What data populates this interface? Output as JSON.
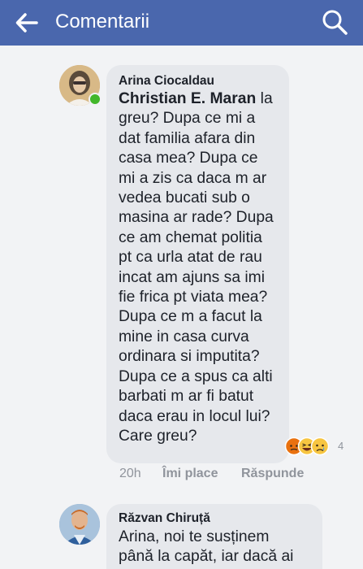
{
  "topbar": {
    "title": "Comentarii",
    "back_icon": "arrow-left-icon",
    "search_icon": "search-icon",
    "color": "#4a67ad"
  },
  "comments": [
    {
      "author": "Arina Ciocaldau",
      "mention": "Christian E. Maran",
      "lines": [
        " la",
        "greu? Dupa ce mi a",
        "dat familia afara din",
        "casa mea? Dupa ce",
        "mi a zis ca daca m ar",
        "vedea bucati sub o",
        "masina ar rade? Dupa",
        "ce am chemat politia",
        "pt ca urla atat de rau",
        "incat am ajuns sa imi",
        "fie frica pt viata mea?",
        "Dupa ce m a facut la",
        "mine in casa curva",
        "ordinara si imputita?",
        "Dupa ce a spus ca alti",
        "barbati m ar fi batut",
        "daca erau in locul lui?",
        "Care greu?"
      ],
      "reactions": [
        "angry-reaction-icon",
        "haha-reaction-icon",
        "sad-reaction-icon"
      ],
      "reaction_count": "4",
      "time": "20h",
      "like_label": "Îmi place",
      "reply_label": "Răspunde",
      "online": true
    },
    {
      "author": "Răzvan Chiruță",
      "lines": [
        "Arina, noi te susținem",
        "până la capăt, iar dacă ai"
      ]
    }
  ]
}
